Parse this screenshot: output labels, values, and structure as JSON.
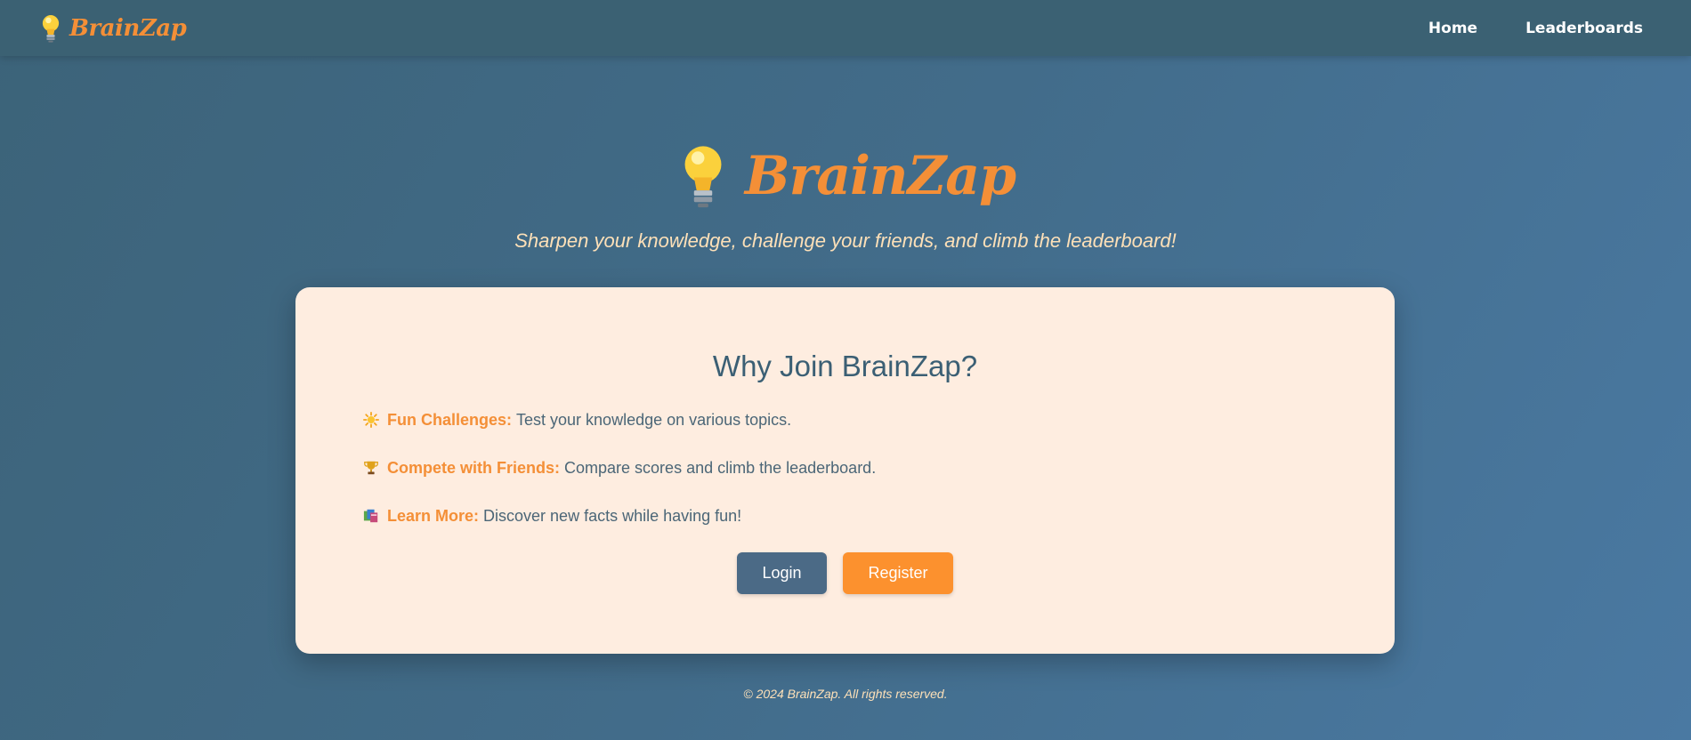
{
  "nav": {
    "brand": "BrainZap",
    "brand_icon": "lightbulb-icon",
    "links": [
      "Home",
      "Leaderboards"
    ]
  },
  "hero": {
    "title": "BrainZap",
    "icon": "lightbulb-icon",
    "tagline": "Sharpen your knowledge, challenge your friends, and climb the leaderboard!"
  },
  "card": {
    "title": "Why Join BrainZap?",
    "features": [
      {
        "icon": "sun-icon",
        "title": "Fun Challenges:",
        "text": "Test your knowledge on various topics."
      },
      {
        "icon": "trophy-icon",
        "title": "Compete with Friends:",
        "text": "Compare scores and climb the leaderboard."
      },
      {
        "icon": "books-icon",
        "title": "Learn More:",
        "text": "Discover new facts while having fun!"
      }
    ],
    "buttons": {
      "login": "Login",
      "register": "Register"
    }
  },
  "footer": {
    "text": "© 2024 BrainZap. All rights reserved."
  },
  "colors": {
    "accent": "#f48f37",
    "navbar": "#3b6173",
    "card_background": "#feede0",
    "login_button": "#4b6a86",
    "register_button": "#fc912e",
    "tagline": "#fde0b8"
  }
}
